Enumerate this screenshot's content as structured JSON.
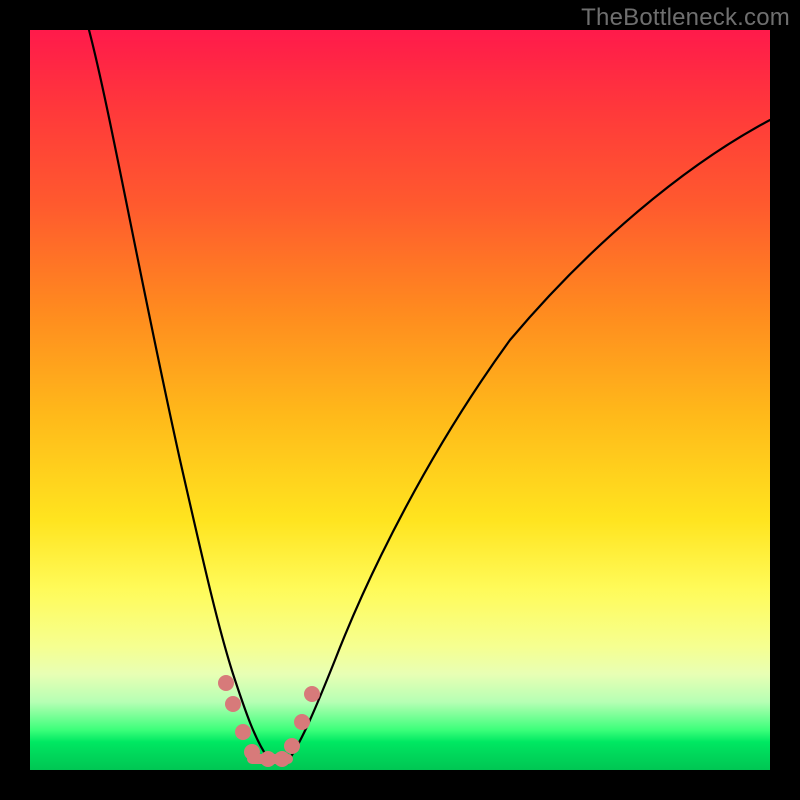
{
  "watermark": "TheBottleneck.com",
  "chart_data": {
    "type": "line",
    "title": "",
    "xlabel": "",
    "ylabel": "",
    "xlim": [
      0,
      100
    ],
    "ylim": [
      0,
      100
    ],
    "grid": false,
    "legend": false,
    "background": "rainbow-gradient",
    "annotations": [
      "minimum near x≈32, y≈0"
    ],
    "series": [
      {
        "name": "bottleneck-curve",
        "x": [
          8,
          10,
          12,
          15,
          18,
          21,
          24,
          26,
          28,
          30,
          32,
          34,
          36,
          38,
          42,
          48,
          55,
          65,
          75,
          85,
          95,
          100
        ],
        "y": [
          100,
          90,
          78,
          62,
          48,
          36,
          24,
          15,
          8,
          3,
          0,
          0,
          2,
          5,
          12,
          22,
          34,
          48,
          60,
          70,
          78,
          82
        ]
      }
    ],
    "markers": {
      "name": "highlight-points",
      "color": "#d77a7a",
      "x": [
        25.5,
        26.5,
        28.5,
        30.0,
        32.0,
        34.0,
        35.0,
        36.5,
        37.8
      ],
      "y": [
        11,
        8,
        3,
        0.5,
        0,
        0,
        2,
        6,
        10
      ]
    }
  },
  "colors": {
    "page_bg": "#000000",
    "gradient_top": "#ff1a4b",
    "gradient_mid": "#ffe41f",
    "gradient_bottom": "#00d85b",
    "curve": "#000000",
    "marker": "#d77a7a",
    "watermark": "#6f6f6f"
  }
}
